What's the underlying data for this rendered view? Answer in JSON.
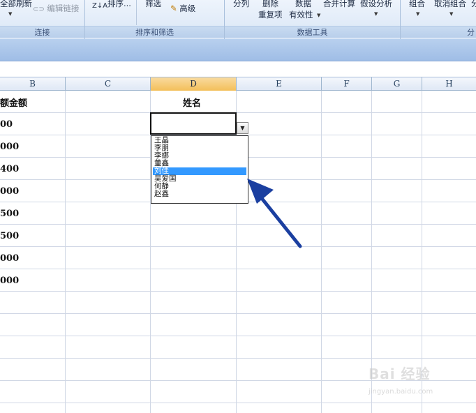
{
  "ribbon": {
    "groups": [
      {
        "label": "连接",
        "buttons": {
          "refresh_all": "全部刷新",
          "edit_links": "编辑链接"
        }
      },
      {
        "label": "排序和筛选",
        "buttons": {
          "sort_az": "Z↓A",
          "sort": "排序...",
          "filter": "筛选",
          "advanced": "高级"
        }
      },
      {
        "label": "数据工具",
        "buttons": {
          "text_to_columns": "分列",
          "remove_dup_top": "删除",
          "remove_dup_bottom": "重复项",
          "validation_top": "数据",
          "validation_bottom": "有效性",
          "consolidate": "合并计算",
          "what_if": "假设分析"
        }
      },
      {
        "label": "分",
        "buttons": {
          "group": "组合",
          "ungroup": "取消组合",
          "subtotal": "分"
        }
      }
    ]
  },
  "sheet": {
    "columns": [
      "B",
      "C",
      "D",
      "E",
      "F",
      "G",
      "H"
    ],
    "active_column": "D",
    "header_row": {
      "b": "额金额",
      "d": "姓名"
    },
    "b_values": [
      "00",
      "000",
      "400",
      "000",
      "500",
      "500",
      "000",
      "000"
    ]
  },
  "dropdown": {
    "items": [
      "王晶",
      "李朋",
      "李娜",
      "董鑫",
      "刘佳",
      "吴爱国",
      "何静",
      "赵鑫"
    ],
    "selected_index": 4
  },
  "watermark": {
    "brand": "Bai 经验",
    "url": "jingyan.baidu.com"
  },
  "colors": {
    "selection": "#3399ff",
    "arrow": "#1b3fa0",
    "active_header": "#f3bf59"
  }
}
